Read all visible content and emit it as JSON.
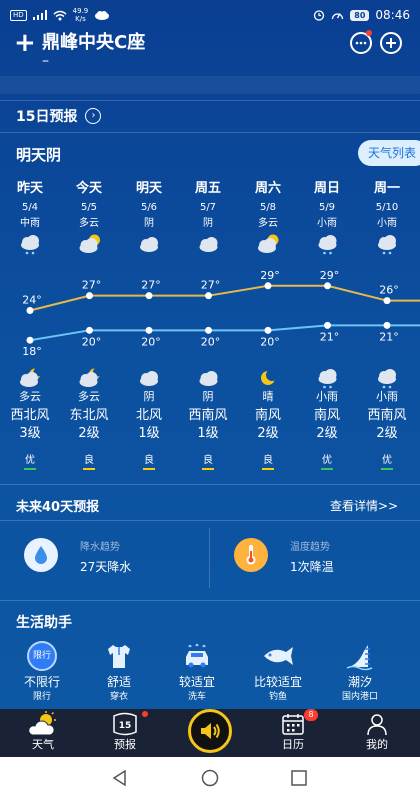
{
  "status_bar": {
    "badge": "HD",
    "speed_value": "49.9",
    "speed_unit": "K/s",
    "battery": "80",
    "time": "08:46"
  },
  "header": {
    "add_glyph": "+",
    "location": "鼎峰中央C座",
    "location_sub": "–"
  },
  "forecast15": {
    "title": "15日预报",
    "summary": "明天阴",
    "list_button": "天气列表"
  },
  "days": [
    {
      "name": "昨天",
      "date": "5/4",
      "day_weather": "中雨",
      "day_icon": "rain-cloud-icon",
      "night_icon": "moon-cloud-icon",
      "night_weather": "多云",
      "wind_dir": "西北风",
      "wind_level": "3级",
      "aqi": "优",
      "aqi_color": "#34c759"
    },
    {
      "name": "今天",
      "date": "5/5",
      "day_weather": "多云",
      "day_icon": "sun-cloud-icon",
      "night_icon": "moon-cloud-icon",
      "night_weather": "多云",
      "wind_dir": "东北风",
      "wind_level": "2级",
      "aqi": "良",
      "aqi_color": "#ffcc00"
    },
    {
      "name": "明天",
      "date": "5/6",
      "day_weather": "阴",
      "day_icon": "cloud-icon",
      "night_icon": "cloud-icon",
      "night_weather": "阴",
      "wind_dir": "北风",
      "wind_level": "1级",
      "aqi": "良",
      "aqi_color": "#ffcc00"
    },
    {
      "name": "周五",
      "date": "5/7",
      "day_weather": "阴",
      "day_icon": "cloud-icon",
      "night_icon": "cloud-icon",
      "night_weather": "阴",
      "wind_dir": "西南风",
      "wind_level": "1级",
      "aqi": "良",
      "aqi_color": "#ffcc00"
    },
    {
      "name": "周六",
      "date": "5/8",
      "day_weather": "多云",
      "day_icon": "sun-cloud-icon",
      "night_icon": "moon-icon",
      "night_weather": "晴",
      "wind_dir": "南风",
      "wind_level": "2级",
      "aqi": "良",
      "aqi_color": "#ffcc00"
    },
    {
      "name": "周日",
      "date": "5/9",
      "day_weather": "小雨",
      "day_icon": "rain-cloud-icon",
      "night_icon": "rain-cloud-icon",
      "night_weather": "小雨",
      "wind_dir": "南风",
      "wind_level": "2级",
      "aqi": "优",
      "aqi_color": "#34c759"
    },
    {
      "name": "周一",
      "date": "5/10",
      "day_weather": "小雨",
      "day_icon": "rain-cloud-icon",
      "night_icon": "rain-cloud-icon",
      "night_weather": "小雨",
      "wind_dir": "西南风",
      "wind_level": "2级",
      "aqi": "优",
      "aqi_color": "#34c759"
    }
  ],
  "chart_data": {
    "type": "line",
    "categories": [
      "昨天",
      "今天",
      "明天",
      "周五",
      "周六",
      "周日",
      "周一"
    ],
    "series": [
      {
        "values": [
          24,
          27,
          27,
          27,
          29,
          29,
          26
        ],
        "color": "#e8b84a"
      },
      {
        "values": [
          18,
          20,
          20,
          20,
          20,
          21,
          21
        ],
        "color": "#6cc4f5"
      }
    ],
    "value_labels_high": [
      "24°",
      "27°",
      "27°",
      "27°",
      "29°",
      "29°",
      "26°"
    ],
    "value_labels_low": [
      "18°",
      "20°",
      "20°",
      "20°",
      "20°",
      "21°",
      "21°"
    ],
    "ylim": [
      14,
      33
    ]
  },
  "forty_day": {
    "title": "未来40天预报",
    "detail_link": "查看详情>>",
    "precip_label": "降水趋势",
    "precip_value": "27天降水",
    "temp_label": "温度趋势",
    "temp_value": "1次降温"
  },
  "life": {
    "title": "生活助手",
    "items": [
      {
        "icon_text": "限行",
        "value": "不限行",
        "name": "限行"
      },
      {
        "value": "舒适",
        "name": "穿衣"
      },
      {
        "value": "较适宜",
        "name": "洗车"
      },
      {
        "value": "比较适宜",
        "name": "钓鱼"
      },
      {
        "value": "潮汐",
        "name": "国内港口"
      }
    ]
  },
  "tabs": {
    "weather": "天气",
    "forecast": "预报",
    "forecast_badge": "15",
    "calendar": "日历",
    "calendar_badge": "8",
    "mine": "我的"
  },
  "colors": {
    "accent_yellow": "#f5c518",
    "good": "#34c759",
    "ok": "#ffcc00"
  }
}
